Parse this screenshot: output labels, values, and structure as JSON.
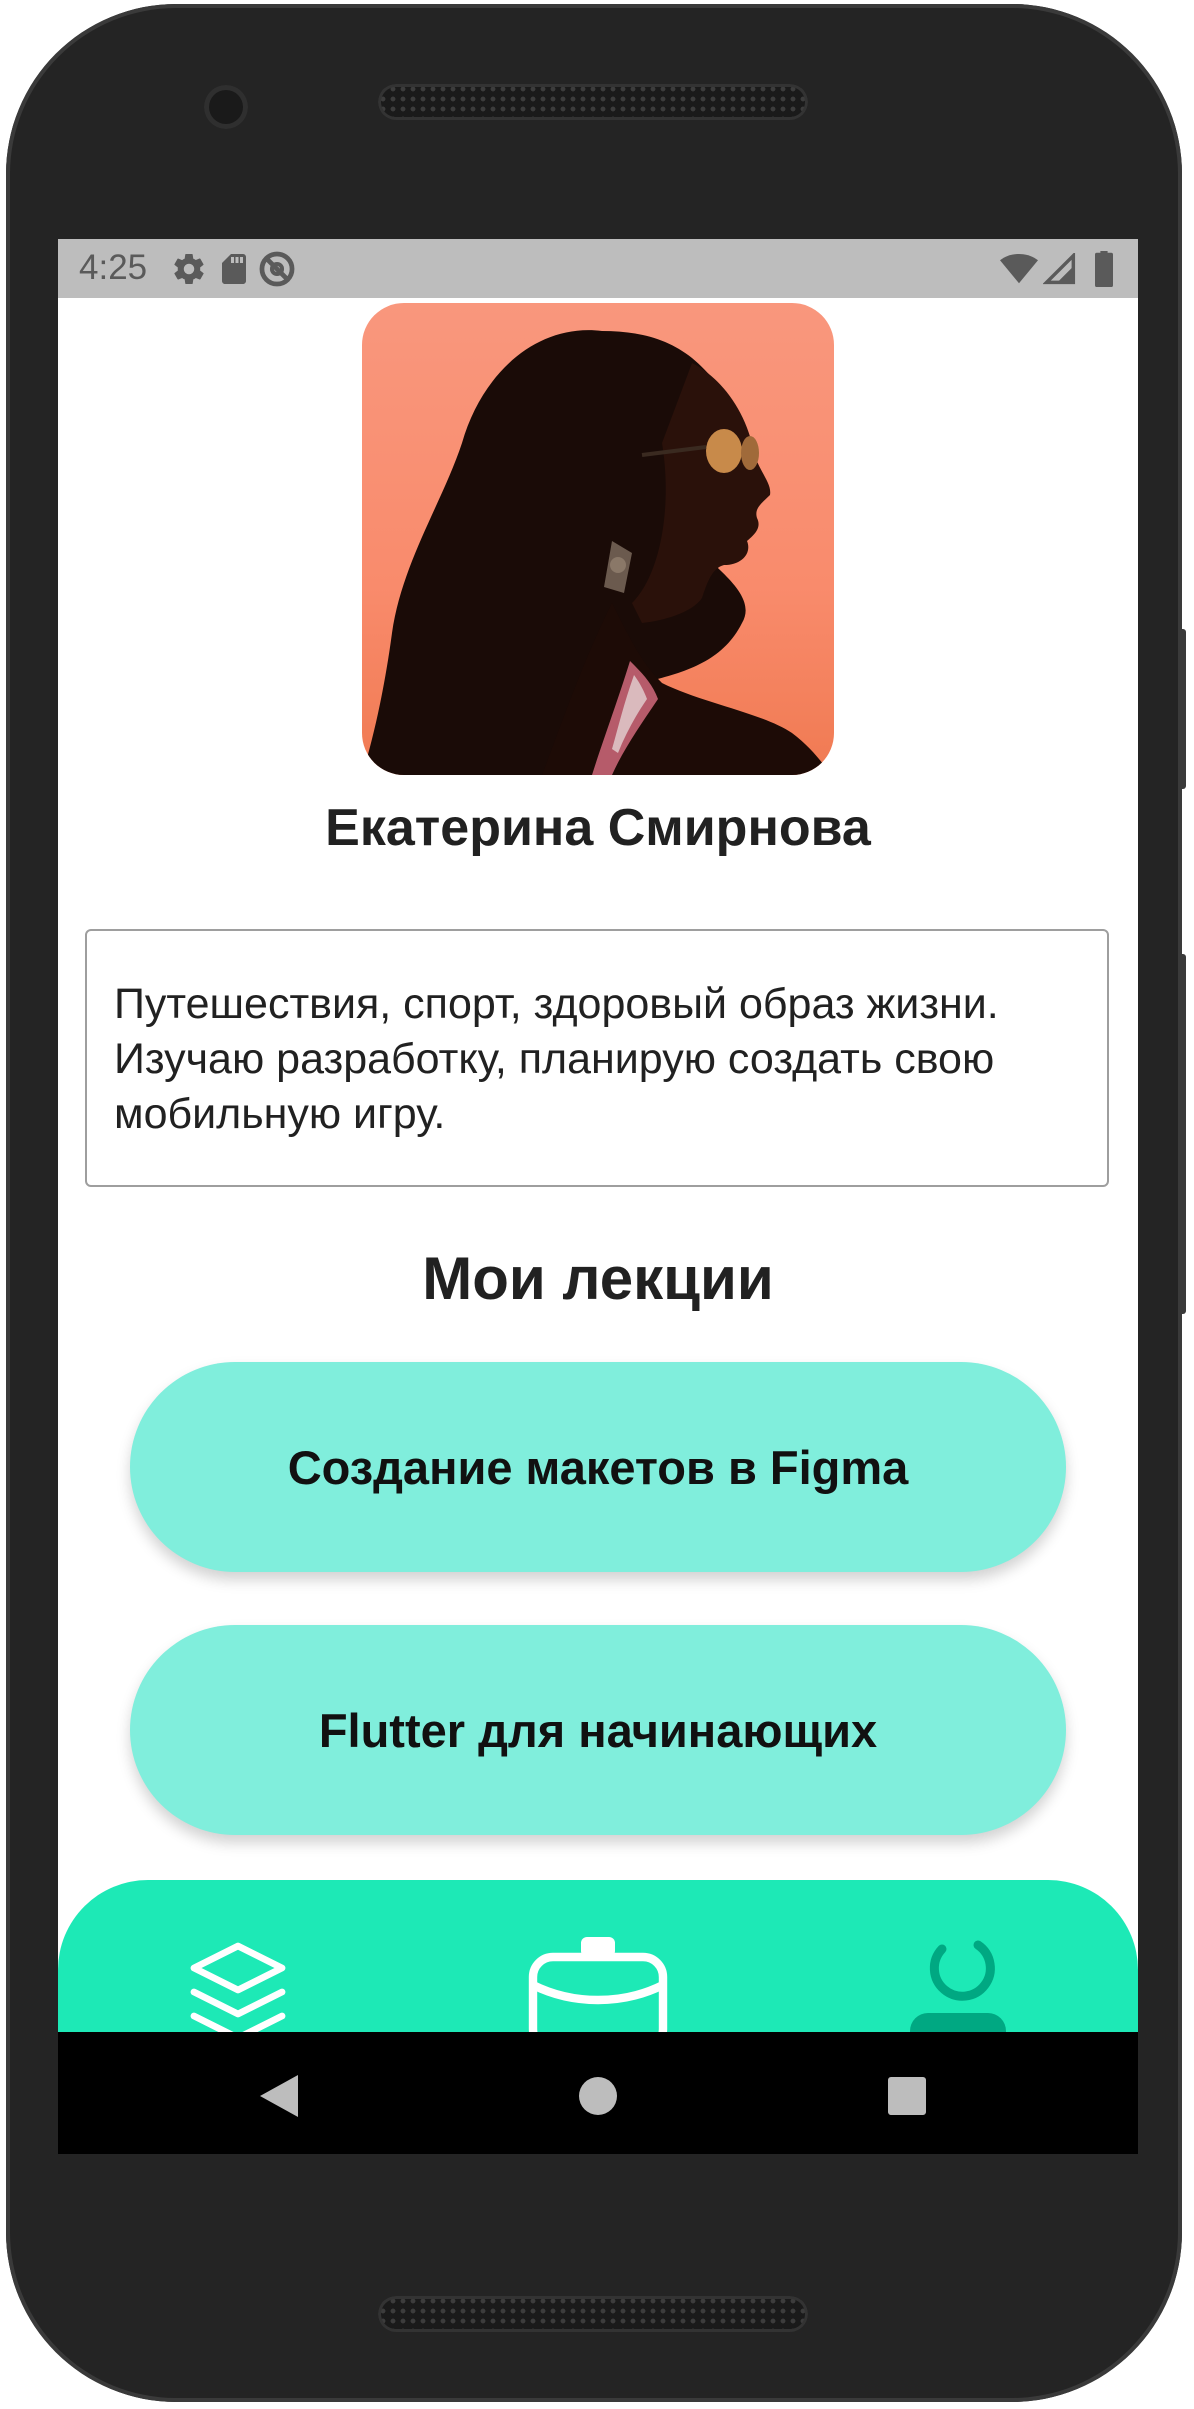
{
  "status_bar": {
    "time": "4:25",
    "icons": [
      "gear-icon",
      "sd-card-icon",
      "do-not-disturb-icon",
      "wifi-icon",
      "signal-icon",
      "battery-icon"
    ]
  },
  "profile": {
    "avatar_alt": "profile-photo",
    "name": "Екатерина Смирнова",
    "bio": "Путешествия, спорт, здоровый образ жизни. Изучаю разработку, планирую создать свою мобильную игру."
  },
  "lectures": {
    "title": "Мои лекции",
    "items": [
      {
        "label": "Создание макетов в Figma"
      },
      {
        "label": "Flutter для начинающих"
      }
    ]
  },
  "bottom_nav": {
    "items": [
      {
        "icon": "layers-icon",
        "active": false
      },
      {
        "icon": "briefcase-icon",
        "active": false
      },
      {
        "icon": "profile-icon",
        "active": true
      }
    ]
  },
  "colors": {
    "accent": "#1de9b6",
    "button": "#80eedc",
    "active_icon": "#00a882",
    "status_bar": "#bdbdbd"
  },
  "system_nav": [
    "back-icon",
    "home-icon",
    "recents-icon"
  ]
}
